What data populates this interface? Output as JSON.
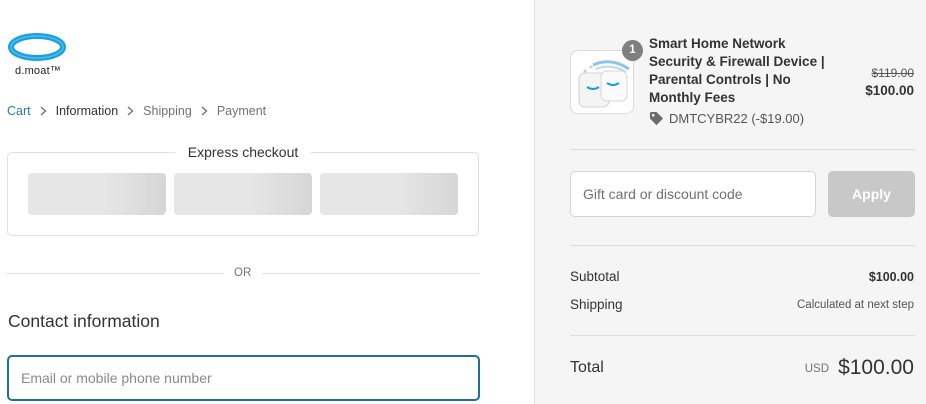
{
  "brand": {
    "logo_text": "d.moat™"
  },
  "breadcrumb": [
    {
      "label": "Cart",
      "state": "link"
    },
    {
      "label": "Information",
      "state": "current"
    },
    {
      "label": "Shipping",
      "state": "upcoming"
    },
    {
      "label": "Payment",
      "state": "upcoming"
    }
  ],
  "express_checkout": {
    "title": "Express checkout",
    "buttons": [
      "",
      "",
      ""
    ]
  },
  "divider": {
    "or_label": "OR"
  },
  "contact": {
    "heading": "Contact information",
    "email_placeholder": "Email or mobile phone number",
    "email_value": ""
  },
  "order": {
    "item": {
      "quantity": "1",
      "name": "Smart Home Network Security & Firewall Device | Parental Controls | No Monthly Fees",
      "discount_code": "DMTCYBR22 (-$19.00)",
      "original_price": "$119.00",
      "price": "$100.00",
      "thumbnail_icon": "router-device-icon"
    },
    "discount_input": {
      "placeholder": "Gift card or discount code",
      "value": ""
    },
    "apply_label": "Apply",
    "subtotal": {
      "label": "Subtotal",
      "value": "$100.00"
    },
    "shipping": {
      "label": "Shipping",
      "value": "Calculated at next step"
    },
    "total": {
      "label": "Total",
      "currency": "USD",
      "value": "$100.00"
    }
  },
  "colors": {
    "accent": "#1f6f9a",
    "link": "#2a7ab0",
    "logo_blue": "#1aa0e0",
    "summary_bg": "#f5f5f5",
    "apply_button_disabled": "#c8c8c8"
  }
}
